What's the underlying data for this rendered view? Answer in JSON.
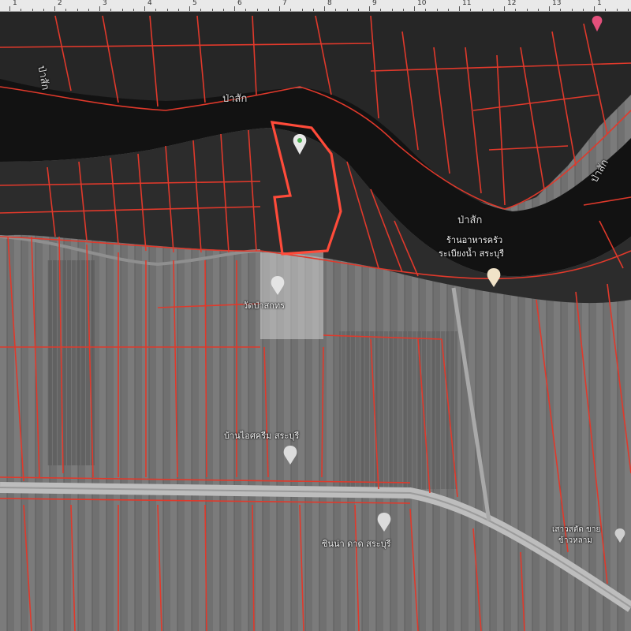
{
  "ruler": {
    "ticks": [
      "1",
      "2",
      "3",
      "4",
      "5",
      "6",
      "7",
      "8",
      "9",
      "10",
      "11",
      "12",
      "13",
      "1"
    ]
  },
  "map": {
    "river_labels": [
      "ป่าสัก",
      "ป่าสัก",
      "ป่าสัก",
      "ป่าสัก"
    ],
    "places": {
      "restaurant_line1": "ร้านอาหารครัว",
      "restaurant_line2": "ระเบียงน้ำ สระบุรี",
      "place_center": "วัดป่าสกทร",
      "village": "บ้านไอศครีม สระบุรี",
      "place_south": "ซินน่า ดาด สระบุรี",
      "place_right_line1": "เสาวสตัด ขาย",
      "place_right_line2": "ข้าวหลาม"
    },
    "colors": {
      "parcel_line": "#e0392b",
      "selected_parcel": "#ff4b3a",
      "river": "#121212",
      "farmland": "#6e6e6e",
      "road": "#bdbdbd",
      "marker": "#efefef",
      "pin_pink": "#e4507c"
    }
  }
}
